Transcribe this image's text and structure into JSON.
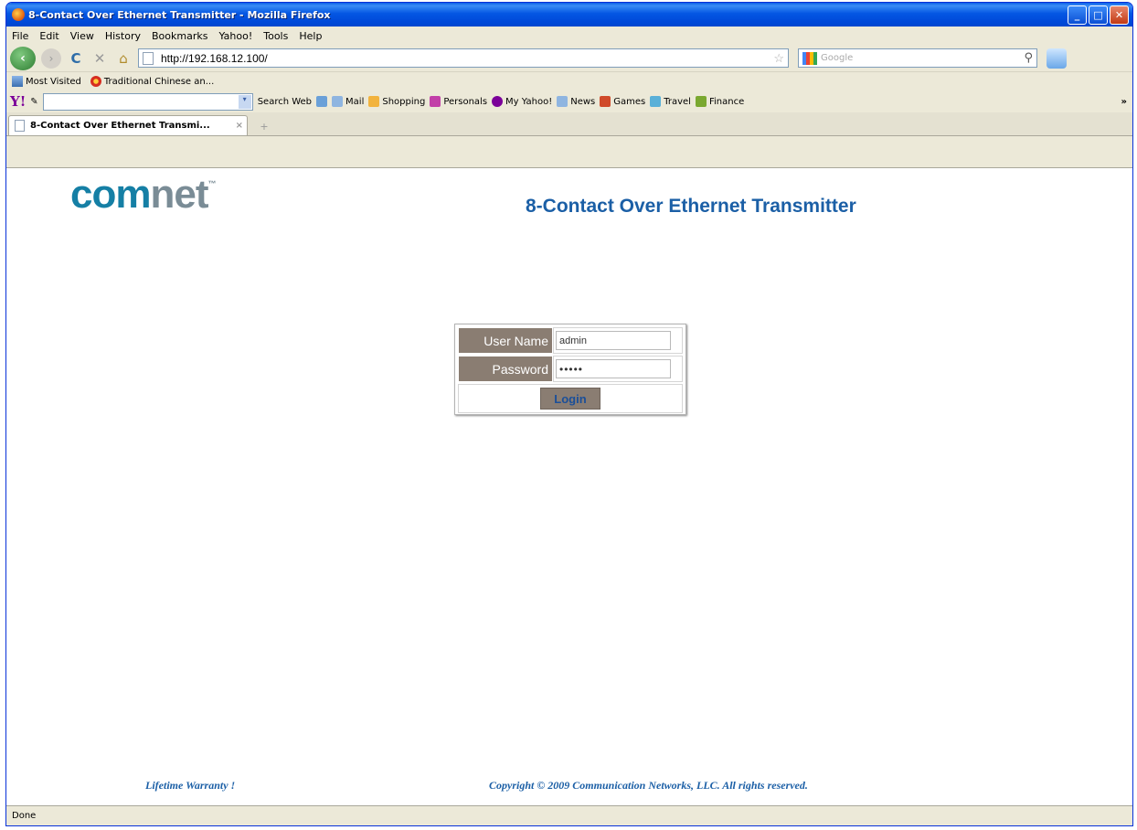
{
  "window": {
    "title": "8-Contact Over Ethernet Transmitter - Mozilla Firefox",
    "buttons": {
      "minimize": "_",
      "maximize": "□",
      "close": "✕"
    }
  },
  "menu": [
    "File",
    "Edit",
    "View",
    "History",
    "Bookmarks",
    "Yahoo!",
    "Tools",
    "Help"
  ],
  "nav": {
    "url": "http://192.168.12.100/",
    "search_placeholder": "Google"
  },
  "bookmarks": [
    {
      "label": "Most Visited",
      "icon": "most-visited-icon"
    },
    {
      "label": "Traditional Chinese an...",
      "icon": "flower-icon"
    }
  ],
  "yahoo_toolbar": {
    "logo": "Y!",
    "items": [
      {
        "label": "Search Web",
        "color": "#ffffff"
      },
      {
        "label": "",
        "color": "#6aa0d8"
      },
      {
        "label": "Mail",
        "color": "#8fb5e0"
      },
      {
        "label": "Shopping",
        "color": "#f2b33d"
      },
      {
        "label": "Personals",
        "color": "#c23fa8"
      },
      {
        "label": "My Yahoo!",
        "color": "#7b0099"
      },
      {
        "label": "News",
        "color": "#8fb5e0"
      },
      {
        "label": "Games",
        "color": "#d04a2a"
      },
      {
        "label": "Travel",
        "color": "#5ab0d8"
      },
      {
        "label": "Finance",
        "color": "#7aa830"
      }
    ],
    "more": "»"
  },
  "tab": {
    "label": "8-Contact Over Ethernet Transmi...",
    "close": "×",
    "new": "+"
  },
  "page": {
    "logo_com": "com",
    "logo_net": "net",
    "logo_tm": "™",
    "title": "8-Contact Over Ethernet Transmitter",
    "login": {
      "username_label": "User Name",
      "username_value": "admin",
      "password_label": "Password",
      "password_value": "admin",
      "button": "Login"
    },
    "footer_warranty": "Lifetime Warranty !",
    "footer_copyright": "Copyright © 2009 Communication Networks, LLC. All rights reserved."
  },
  "status": "Done"
}
